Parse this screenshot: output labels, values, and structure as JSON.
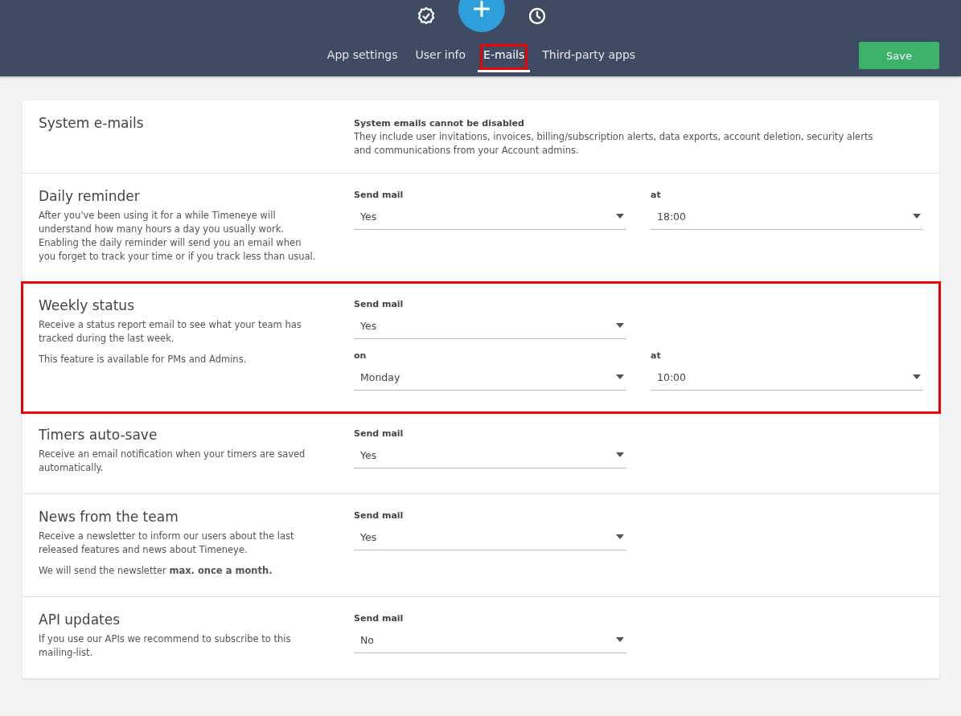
{
  "header": {
    "tabs": [
      {
        "label": "App settings",
        "selected": false,
        "highlighted": false
      },
      {
        "label": "User info",
        "selected": false,
        "highlighted": false
      },
      {
        "label": "E-mails",
        "selected": true,
        "highlighted": true
      },
      {
        "label": "Third-party apps",
        "selected": false,
        "highlighted": false
      }
    ],
    "save_button": "Save"
  },
  "sections": [
    {
      "kind": "info",
      "title": "System e-mails",
      "highlighted": false,
      "note_title": "System emails cannot be disabled",
      "note_text": "They include user invitations, invoices, billing/subscription alerts, data exports, account deletion, security alerts and communications from your Account admins."
    },
    {
      "kind": "settings",
      "title": "Daily reminder",
      "highlighted": false,
      "paragraphs": [
        "After you've been using it for a while Timeneye will understand how many hours a day you usually work. Enabling the daily reminder will send you an email when you forget to track your time or if you track less than usual."
      ],
      "rows": [
        [
          {
            "label": "Send mail",
            "value": "Yes"
          },
          {
            "label": "at",
            "value": "18:00"
          }
        ]
      ]
    },
    {
      "kind": "settings",
      "title": "Weekly status",
      "highlighted": true,
      "paragraphs": [
        "Receive a status report email to see what your team has tracked during the last week.",
        "This feature is available for PMs and Admins."
      ],
      "rows": [
        [
          {
            "label": "Send mail",
            "value": "Yes"
          }
        ],
        [
          {
            "label": "on",
            "value": "Monday"
          },
          {
            "label": "at",
            "value": "10:00"
          }
        ]
      ]
    },
    {
      "kind": "settings",
      "title": "Timers auto-save",
      "highlighted": false,
      "paragraphs": [
        "Receive an email notification when your timers are saved automatically."
      ],
      "rows": [
        [
          {
            "label": "Send mail",
            "value": "Yes"
          }
        ]
      ]
    },
    {
      "kind": "settings",
      "title": "News from the team",
      "highlighted": false,
      "paragraphs": [
        "Receive a newsletter to inform our users about the last released features and news about Timeneye.",
        "We will send the newsletter **max. once a month.**"
      ],
      "rows": [
        [
          {
            "label": "Send mail",
            "value": "Yes"
          }
        ]
      ]
    },
    {
      "kind": "settings",
      "title": "API updates",
      "highlighted": false,
      "paragraphs": [
        "If you use our APIs we recommend to subscribe to this mailing-list."
      ],
      "rows": [
        [
          {
            "label": "Send mail",
            "value": "No"
          }
        ]
      ]
    }
  ]
}
